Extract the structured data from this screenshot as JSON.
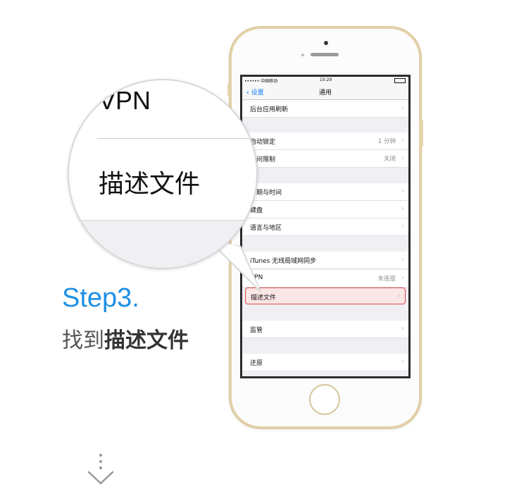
{
  "status_bar": {
    "carrier": "•••••• 中国移动",
    "time": "15:29"
  },
  "nav": {
    "back_label": "设置",
    "title": "通用"
  },
  "rows": [
    {
      "label": "后台应用刷新",
      "value": ""
    },
    {
      "label": "自动锁定",
      "value": "1 分钟"
    },
    {
      "label": "访问限制",
      "value": "关闭"
    },
    {
      "label": "日期与时间",
      "value": ""
    },
    {
      "label": "键盘",
      "value": ""
    },
    {
      "label": "语言与地区",
      "value": ""
    },
    {
      "label": "iTunes 无线局域网同步",
      "value": ""
    },
    {
      "label": "VPN",
      "value": "未连接"
    },
    {
      "label": "描述文件",
      "value": ""
    },
    {
      "label": "监管",
      "value": ""
    },
    {
      "label": "还原",
      "value": ""
    }
  ],
  "magnifier": {
    "top_text": "VPN",
    "main_text": "描述文件"
  },
  "step": {
    "title": "Step3.",
    "caption_prefix": "找到",
    "caption_bold": "描述文件"
  },
  "colors": {
    "accent": "#1e90e6",
    "highlight_border": "#e04747",
    "ios_blue": "#157efb"
  },
  "icons": [
    "chevron-right-icon",
    "back-chevron-icon",
    "down-arrow-icon"
  ]
}
